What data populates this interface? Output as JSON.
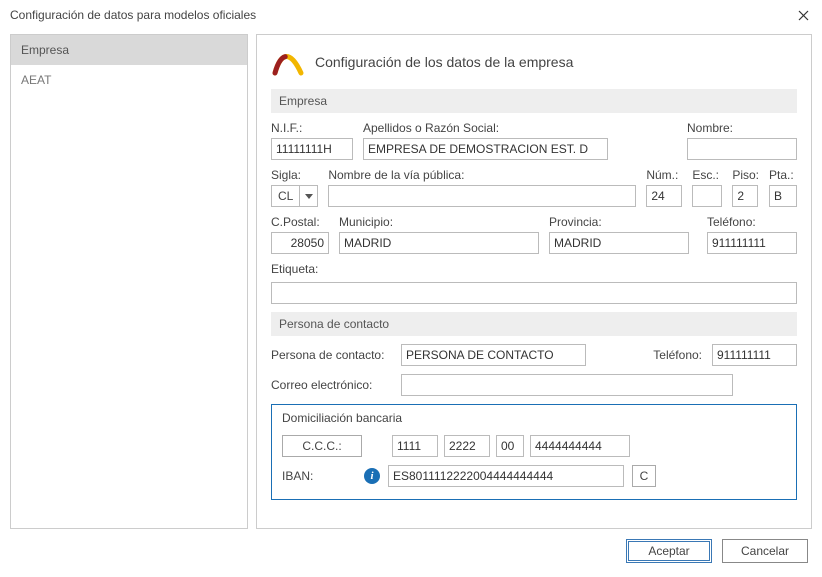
{
  "window": {
    "title": "Configuración de datos para modelos oficiales"
  },
  "sidebar": {
    "items": [
      {
        "label": "Empresa",
        "active": true
      },
      {
        "label": "AEAT",
        "active": false
      }
    ]
  },
  "heading": "Configuración de los datos de la empresa",
  "section_empresa": {
    "title": "Empresa",
    "nif_label": "N.I.F.:",
    "nif_value": "11111111H",
    "razon_label": "Apellidos o Razón Social:",
    "razon_value": "EMPRESA DE DEMOSTRACION EST. D",
    "nombre_label": "Nombre:",
    "nombre_value": "",
    "sigla_label": "Sigla:",
    "sigla_value": "CL",
    "via_label": "Nombre de la vía pública:",
    "via_value": "",
    "num_label": "Núm.:",
    "num_value": "24",
    "esc_label": "Esc.:",
    "esc_value": "",
    "piso_label": "Piso:",
    "piso_value": "2",
    "pta_label": "Pta.:",
    "pta_value": "B",
    "cp_label": "C.Postal:",
    "cp_value": "28050",
    "mun_label": "Municipio:",
    "mun_value": "MADRID",
    "prov_label": "Provincia:",
    "prov_value": "MADRID",
    "tel_label": "Teléfono:",
    "tel_value": "911111111",
    "etiqueta_label": "Etiqueta:",
    "etiqueta_value": ""
  },
  "section_contacto": {
    "title": "Persona de contacto",
    "contact_label": "Persona de contacto:",
    "contact_value": "PERSONA DE CONTACTO",
    "tel_label": "Teléfono:",
    "tel_value": "911111111",
    "email_label": "Correo electrónico:",
    "email_value": ""
  },
  "section_bank": {
    "title": "Domiciliación bancaria",
    "ccc_label": "C.C.C.:",
    "ccc_bank": "1111",
    "ccc_office": "2222",
    "ccc_dc": "00",
    "ccc_account": "4444444444",
    "iban_label": "IBAN:",
    "iban_value": "ES8011112222004444444444",
    "mini_btn": "C"
  },
  "buttons": {
    "accept": "Aceptar",
    "cancel": "Cancelar"
  }
}
